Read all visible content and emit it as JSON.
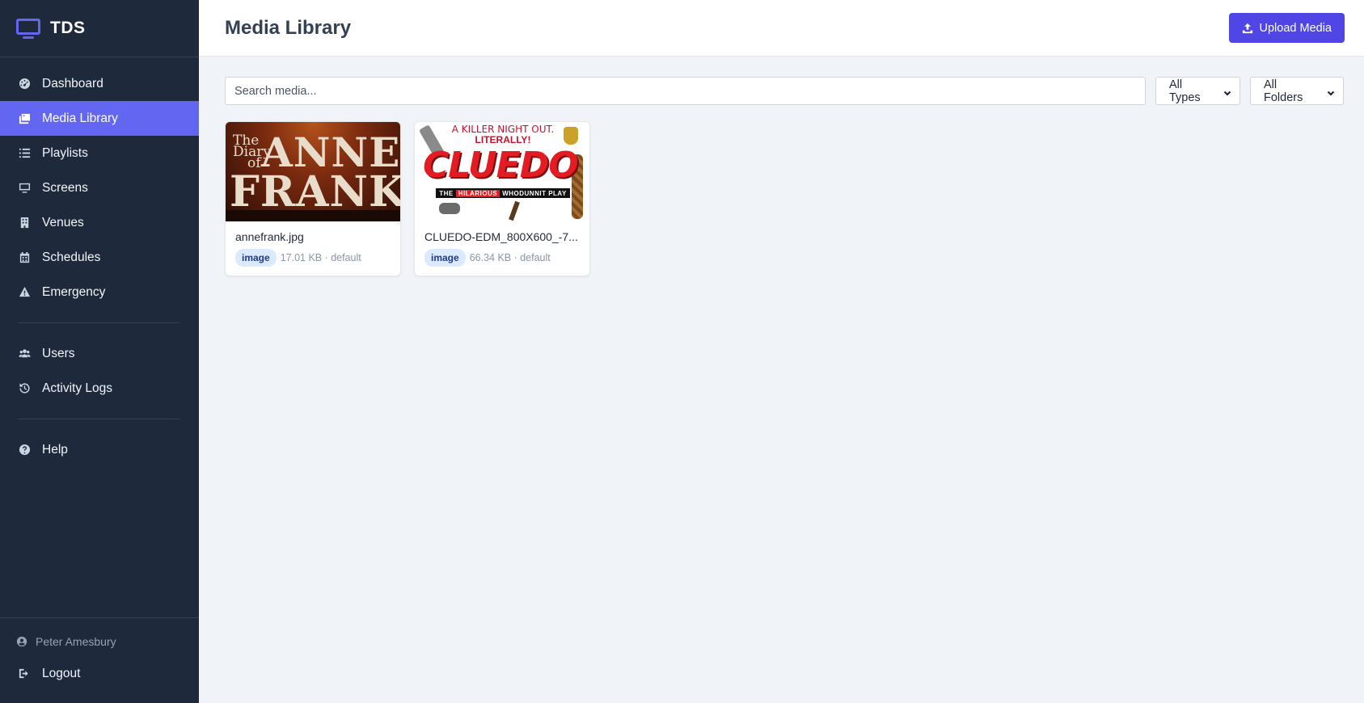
{
  "app": {
    "name": "TDS"
  },
  "sidebar": {
    "items": [
      {
        "label": "Dashboard",
        "icon": "dashboard-icon",
        "active": false
      },
      {
        "label": "Media Library",
        "icon": "media-icon",
        "active": true
      },
      {
        "label": "Playlists",
        "icon": "list-icon",
        "active": false
      },
      {
        "label": "Screens",
        "icon": "monitor-icon",
        "active": false
      },
      {
        "label": "Venues",
        "icon": "building-icon",
        "active": false
      },
      {
        "label": "Schedules",
        "icon": "calendar-icon",
        "active": false
      },
      {
        "label": "Emergency",
        "icon": "warning-icon",
        "active": false
      }
    ],
    "secondary_items": [
      {
        "label": "Users",
        "icon": "users-icon"
      },
      {
        "label": "Activity Logs",
        "icon": "history-icon"
      }
    ],
    "help": {
      "label": "Help",
      "icon": "help-icon"
    },
    "user": {
      "name": "Peter Amesbury"
    },
    "logout": {
      "label": "Logout"
    }
  },
  "header": {
    "title": "Media Library",
    "upload_label": "Upload Media"
  },
  "toolbar": {
    "search_placeholder": "Search media...",
    "type_filter": "All Types",
    "folder_filter": "All Folders"
  },
  "media": [
    {
      "filename": "annefrank.jpg",
      "type": "image",
      "meta": "17.01 KB · default",
      "thumb_text": {
        "line1": "The",
        "line2": "Diary",
        "line3": "of",
        "title1": "ANNE",
        "title2": "FRANK"
      }
    },
    {
      "filename": "CLUEDO-EDM_800X600_-7...",
      "type": "image",
      "meta": "66.34 KB · default",
      "thumb_text": {
        "tag1": "A KILLER NIGHT OUT.",
        "tag2": "LITERALLY!",
        "title": "CLUEDO",
        "strip_a": "THE",
        "strip_b": "HILARIOUS",
        "strip_c": "WHODUNNIT PLAY"
      }
    }
  ],
  "colors": {
    "accent": "#6366f1",
    "sidebar_bg": "#1e293b",
    "button": "#4f46e5"
  }
}
